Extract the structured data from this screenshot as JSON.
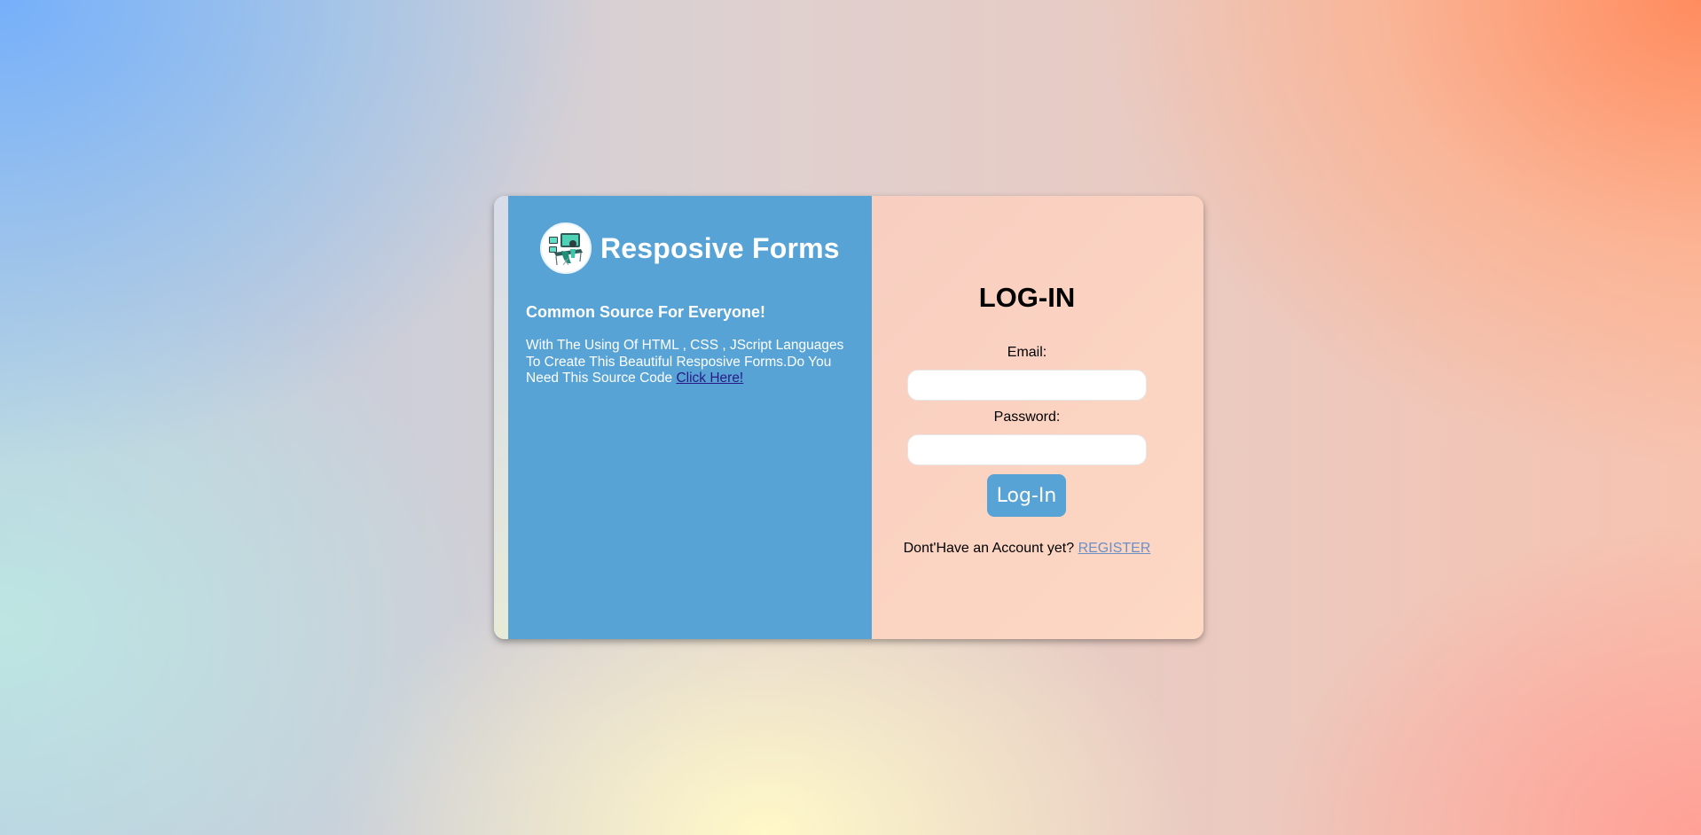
{
  "left_panel": {
    "brand_title": "Resposive Forms",
    "logo_icon": "workspace-illustration-icon",
    "tagline": "Common Source For Everyone!",
    "description": "With The Using Of HTML , CSS , JScript Languages To Create This Beautiful Resposive Forms.Do You Need This Source Code ",
    "link_label": "Click Here!"
  },
  "login": {
    "title": "LOG-IN",
    "email_label": "Email:",
    "email_value": "",
    "password_label": "Password:",
    "password_value": "",
    "submit_label": "Log-In",
    "signup_prompt": "Dont'Have an Account yet? ",
    "signup_link": "REGISTER"
  },
  "colors": {
    "panel_blue": "#57a3d6",
    "link_dark": "#2a1a86",
    "link_register": "#6b8fc7"
  }
}
